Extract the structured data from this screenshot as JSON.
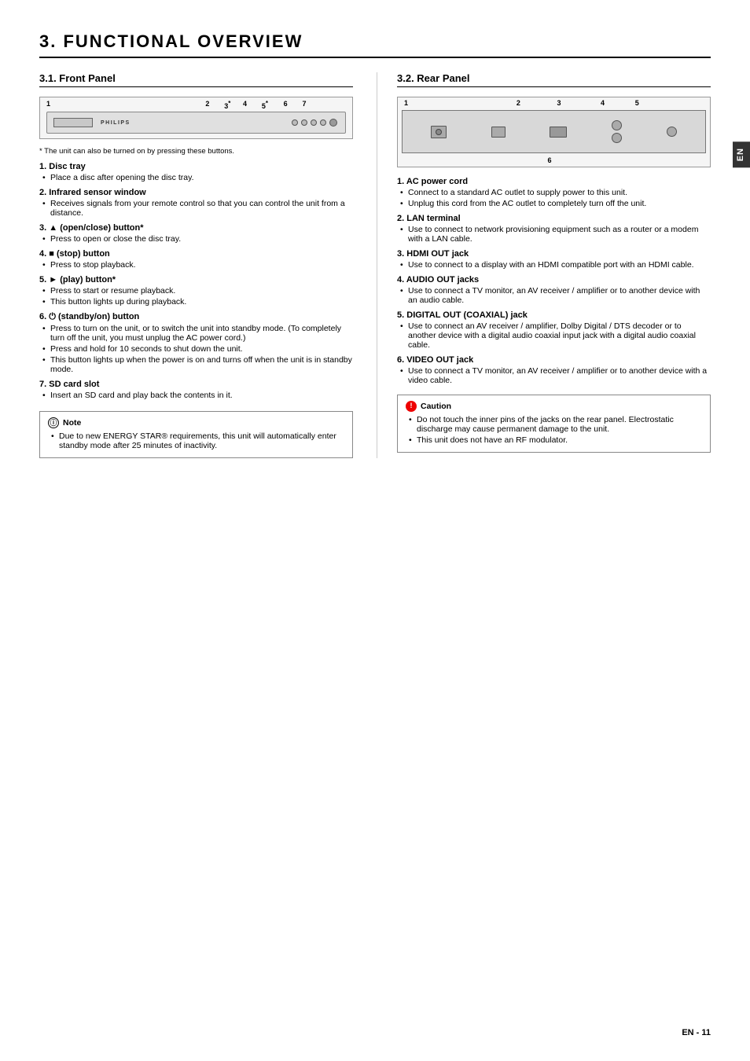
{
  "page": {
    "main_title": "3.   FUNCTIONAL OVERVIEW",
    "side_tab": "EN",
    "page_number": "EN - 11"
  },
  "left": {
    "section_title": "3.1.   Front Panel",
    "asterisk_note": "The unit can also be turned on by pressing these buttons.",
    "items": [
      {
        "number": "1.",
        "title": "Disc tray",
        "bullets": [
          "Place a disc after opening the disc tray."
        ]
      },
      {
        "number": "2.",
        "title": "Infrared sensor window",
        "bullets": [
          "Receives signals from your remote control so that you can control the unit from a distance."
        ]
      },
      {
        "number": "3.",
        "title": "▲ (open/close) button*",
        "bullets": [
          "Press to open or close the disc tray."
        ]
      },
      {
        "number": "4.",
        "title": "■ (stop) button",
        "bullets": [
          "Press to stop playback."
        ]
      },
      {
        "number": "5.",
        "title": "► (play) button*",
        "bullets": [
          "Press to start or resume playback.",
          "This button lights up during playback."
        ]
      },
      {
        "number": "6.",
        "title": "⏻ (standby/on) button",
        "bullets": [
          "Press to turn on the unit, or to switch the unit into standby mode. (To completely turn off the unit, you must unplug the AC power cord.)",
          "Press and hold for 10 seconds to shut down the unit.",
          "This button lights up when the power is on and turns off when the unit is in standby mode."
        ]
      },
      {
        "number": "7.",
        "title": "SD card slot",
        "bullets": [
          "Insert an SD card and play back the contents in it."
        ]
      }
    ],
    "note": {
      "header": "Note",
      "bullets": [
        "Due to new ENERGY STAR® requirements, this unit will automatically enter standby mode after 25 minutes of inactivity."
      ]
    }
  },
  "right": {
    "section_title": "3.2.   Rear Panel",
    "items": [
      {
        "number": "1.",
        "title": "AC power cord",
        "bullets": [
          "Connect to a standard AC outlet to supply power to this unit.",
          "Unplug this cord from the AC outlet to completely turn off the unit."
        ]
      },
      {
        "number": "2.",
        "title": "LAN terminal",
        "bullets": [
          "Use to connect to network provisioning equipment such as a router or a modem with a LAN cable."
        ]
      },
      {
        "number": "3.",
        "title": "HDMI OUT jack",
        "bullets": [
          "Use to connect to a display with an HDMI compatible port with an HDMI cable."
        ]
      },
      {
        "number": "4.",
        "title": "AUDIO OUT jacks",
        "bullets": [
          "Use to connect a TV monitor, an AV receiver / amplifier or to another device with an audio cable."
        ]
      },
      {
        "number": "5.",
        "title": "DIGITAL OUT (COAXIAL) jack",
        "bullets": [
          "Use to connect an AV receiver / amplifier, Dolby Digital / DTS decoder or to another device with a digital audio coaxial input jack with a digital audio coaxial cable."
        ]
      },
      {
        "number": "6.",
        "title": "VIDEO OUT jack",
        "bullets": [
          "Use to connect a TV monitor, an AV receiver / amplifier or to another device with a video cable."
        ]
      }
    ],
    "caution": {
      "header": "Caution",
      "bullets": [
        "Do not touch the inner pins of the jacks on the rear panel. Electrostatic discharge may cause permanent damage to the unit.",
        "This unit does not have an RF modulator."
      ]
    }
  },
  "front_panel_diagram": {
    "numbers": "1   2 3* 4  5* 6 7"
  },
  "rear_panel_diagram": {
    "numbers_top": "1   2  3  4 5",
    "number_bottom": "6"
  }
}
